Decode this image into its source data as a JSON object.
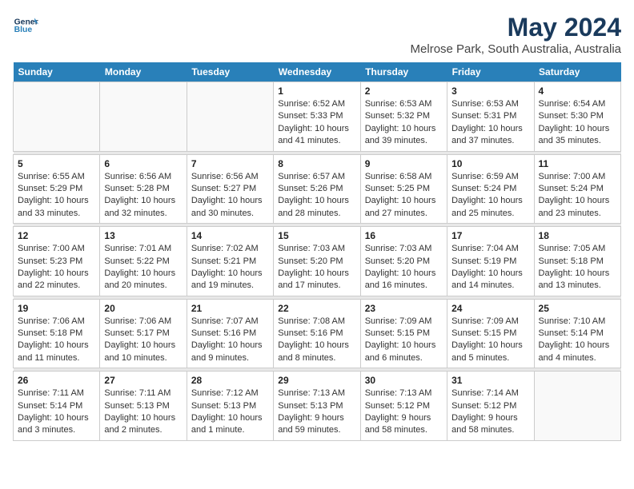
{
  "header": {
    "logo_line1": "General",
    "logo_line2": "Blue",
    "title": "May 2024",
    "subtitle": "Melrose Park, South Australia, Australia"
  },
  "calendar": {
    "days_of_week": [
      "Sunday",
      "Monday",
      "Tuesday",
      "Wednesday",
      "Thursday",
      "Friday",
      "Saturday"
    ],
    "weeks": [
      [
        {
          "day": "",
          "info": ""
        },
        {
          "day": "",
          "info": ""
        },
        {
          "day": "",
          "info": ""
        },
        {
          "day": "1",
          "info": "Sunrise: 6:52 AM\nSunset: 5:33 PM\nDaylight: 10 hours\nand 41 minutes."
        },
        {
          "day": "2",
          "info": "Sunrise: 6:53 AM\nSunset: 5:32 PM\nDaylight: 10 hours\nand 39 minutes."
        },
        {
          "day": "3",
          "info": "Sunrise: 6:53 AM\nSunset: 5:31 PM\nDaylight: 10 hours\nand 37 minutes."
        },
        {
          "day": "4",
          "info": "Sunrise: 6:54 AM\nSunset: 5:30 PM\nDaylight: 10 hours\nand 35 minutes."
        }
      ],
      [
        {
          "day": "5",
          "info": "Sunrise: 6:55 AM\nSunset: 5:29 PM\nDaylight: 10 hours\nand 33 minutes."
        },
        {
          "day": "6",
          "info": "Sunrise: 6:56 AM\nSunset: 5:28 PM\nDaylight: 10 hours\nand 32 minutes."
        },
        {
          "day": "7",
          "info": "Sunrise: 6:56 AM\nSunset: 5:27 PM\nDaylight: 10 hours\nand 30 minutes."
        },
        {
          "day": "8",
          "info": "Sunrise: 6:57 AM\nSunset: 5:26 PM\nDaylight: 10 hours\nand 28 minutes."
        },
        {
          "day": "9",
          "info": "Sunrise: 6:58 AM\nSunset: 5:25 PM\nDaylight: 10 hours\nand 27 minutes."
        },
        {
          "day": "10",
          "info": "Sunrise: 6:59 AM\nSunset: 5:24 PM\nDaylight: 10 hours\nand 25 minutes."
        },
        {
          "day": "11",
          "info": "Sunrise: 7:00 AM\nSunset: 5:24 PM\nDaylight: 10 hours\nand 23 minutes."
        }
      ],
      [
        {
          "day": "12",
          "info": "Sunrise: 7:00 AM\nSunset: 5:23 PM\nDaylight: 10 hours\nand 22 minutes."
        },
        {
          "day": "13",
          "info": "Sunrise: 7:01 AM\nSunset: 5:22 PM\nDaylight: 10 hours\nand 20 minutes."
        },
        {
          "day": "14",
          "info": "Sunrise: 7:02 AM\nSunset: 5:21 PM\nDaylight: 10 hours\nand 19 minutes."
        },
        {
          "day": "15",
          "info": "Sunrise: 7:03 AM\nSunset: 5:20 PM\nDaylight: 10 hours\nand 17 minutes."
        },
        {
          "day": "16",
          "info": "Sunrise: 7:03 AM\nSunset: 5:20 PM\nDaylight: 10 hours\nand 16 minutes."
        },
        {
          "day": "17",
          "info": "Sunrise: 7:04 AM\nSunset: 5:19 PM\nDaylight: 10 hours\nand 14 minutes."
        },
        {
          "day": "18",
          "info": "Sunrise: 7:05 AM\nSunset: 5:18 PM\nDaylight: 10 hours\nand 13 minutes."
        }
      ],
      [
        {
          "day": "19",
          "info": "Sunrise: 7:06 AM\nSunset: 5:18 PM\nDaylight: 10 hours\nand 11 minutes."
        },
        {
          "day": "20",
          "info": "Sunrise: 7:06 AM\nSunset: 5:17 PM\nDaylight: 10 hours\nand 10 minutes."
        },
        {
          "day": "21",
          "info": "Sunrise: 7:07 AM\nSunset: 5:16 PM\nDaylight: 10 hours\nand 9 minutes."
        },
        {
          "day": "22",
          "info": "Sunrise: 7:08 AM\nSunset: 5:16 PM\nDaylight: 10 hours\nand 8 minutes."
        },
        {
          "day": "23",
          "info": "Sunrise: 7:09 AM\nSunset: 5:15 PM\nDaylight: 10 hours\nand 6 minutes."
        },
        {
          "day": "24",
          "info": "Sunrise: 7:09 AM\nSunset: 5:15 PM\nDaylight: 10 hours\nand 5 minutes."
        },
        {
          "day": "25",
          "info": "Sunrise: 7:10 AM\nSunset: 5:14 PM\nDaylight: 10 hours\nand 4 minutes."
        }
      ],
      [
        {
          "day": "26",
          "info": "Sunrise: 7:11 AM\nSunset: 5:14 PM\nDaylight: 10 hours\nand 3 minutes."
        },
        {
          "day": "27",
          "info": "Sunrise: 7:11 AM\nSunset: 5:13 PM\nDaylight: 10 hours\nand 2 minutes."
        },
        {
          "day": "28",
          "info": "Sunrise: 7:12 AM\nSunset: 5:13 PM\nDaylight: 10 hours\nand 1 minute."
        },
        {
          "day": "29",
          "info": "Sunrise: 7:13 AM\nSunset: 5:13 PM\nDaylight: 9 hours\nand 59 minutes."
        },
        {
          "day": "30",
          "info": "Sunrise: 7:13 AM\nSunset: 5:12 PM\nDaylight: 9 hours\nand 58 minutes."
        },
        {
          "day": "31",
          "info": "Sunrise: 7:14 AM\nSunset: 5:12 PM\nDaylight: 9 hours\nand 58 minutes."
        },
        {
          "day": "",
          "info": ""
        }
      ]
    ]
  }
}
